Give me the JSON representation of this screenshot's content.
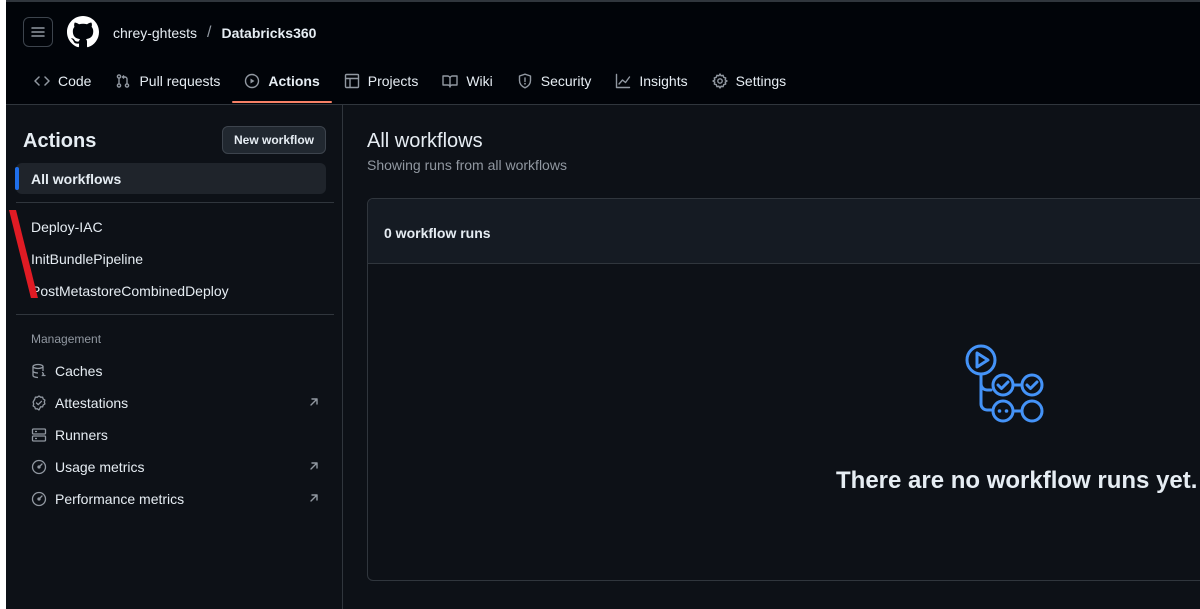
{
  "header": {
    "owner": "chrey-ghtests",
    "separator": "/",
    "repo": "Databricks360",
    "tabs": [
      {
        "label": "Code",
        "icon": "code-icon"
      },
      {
        "label": "Pull requests",
        "icon": "git-pull-request-icon"
      },
      {
        "label": "Actions",
        "icon": "play-icon",
        "active": true
      },
      {
        "label": "Projects",
        "icon": "table-icon"
      },
      {
        "label": "Wiki",
        "icon": "book-icon"
      },
      {
        "label": "Security",
        "icon": "shield-icon"
      },
      {
        "label": "Insights",
        "icon": "graph-icon"
      },
      {
        "label": "Settings",
        "icon": "gear-icon"
      }
    ]
  },
  "sidebar": {
    "title": "Actions",
    "new_workflow_label": "New workflow",
    "all_workflows_label": "All workflows",
    "workflows": [
      "Deploy-IAC",
      "InitBundlePipeline",
      "PostMetastoreCombinedDeploy"
    ],
    "management_label": "Management",
    "management": [
      {
        "label": "Caches",
        "icon": "database-icon"
      },
      {
        "label": "Attestations",
        "icon": "verified-icon",
        "external": true
      },
      {
        "label": "Runners",
        "icon": "server-icon"
      },
      {
        "label": "Usage metrics",
        "icon": "meter-icon",
        "external": true
      },
      {
        "label": "Performance metrics",
        "icon": "meter-icon",
        "external": true
      }
    ]
  },
  "main": {
    "title": "All workflows",
    "subtitle": "Showing runs from all workflows",
    "runs_count_label": "0 workflow runs",
    "empty_message": "There are no workflow runs yet."
  },
  "colors": {
    "background": "#0d1117",
    "header_background": "#010409",
    "active_tab_underline": "#f78166",
    "accent_blue": "#1f6feb",
    "empty_icon_blue": "#4493f8",
    "annotation_red": "#e01b24"
  }
}
